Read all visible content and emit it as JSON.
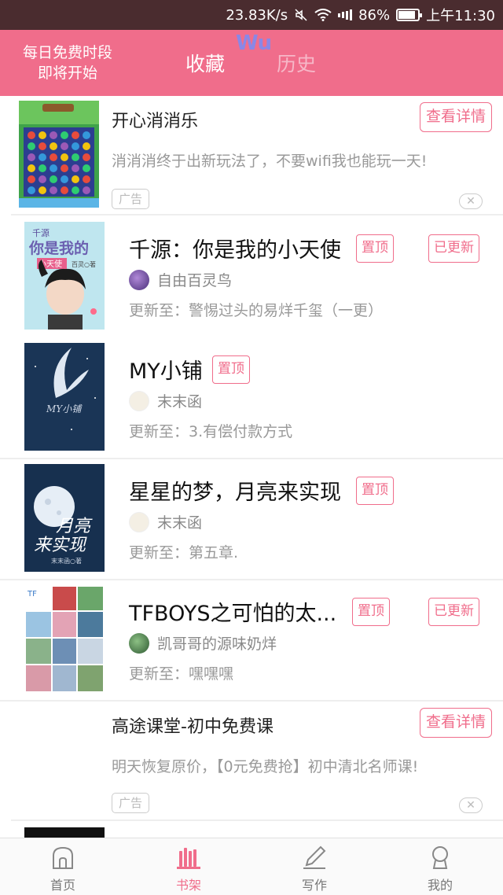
{
  "status_bar": {
    "net_speed": "23.83K/s",
    "battery": "86%",
    "battery_level": 0.86,
    "time": "上午11:30"
  },
  "header": {
    "promo_line1": "每日免费时段",
    "promo_line2": "即将开始",
    "tab_favorites": "收藏",
    "tab_history": "历史",
    "logo": "Wu"
  },
  "ads": [
    {
      "title": "开心消消乐",
      "description": "消消消终于出新玩法了，不要wifi我也能玩一天!",
      "button": "查看详情",
      "tag": "广告",
      "close": "✕"
    },
    {
      "title": "高途课堂-初中免费课",
      "description": "明天恢复原价，【0元免费抢】初中清北名师课!",
      "button": "查看详情",
      "tag": "广告",
      "close": "✕"
    }
  ],
  "books": [
    {
      "title": "千源：你是我的小天使",
      "pin_badge": "置顶",
      "updated_badge": "已更新",
      "author": "自由百灵鸟",
      "update": "更新至：警惕过头的易烊千玺（一更）"
    },
    {
      "title": "MY小铺",
      "pin_badge": "置顶",
      "author": "末末函",
      "update": "更新至：3.有偿付款方式"
    },
    {
      "title": "星星的梦，月亮来实现",
      "pin_badge": "置顶",
      "author": "末末函",
      "update": "更新至：第五章."
    },
    {
      "title": "TFBOYS之可怕的太...",
      "pin_badge": "置顶",
      "updated_badge": "已更新",
      "author": "凯哥哥的源味奶烊",
      "update": "更新至：嘿嘿嘿"
    }
  ],
  "covers": {
    "book1_top": "千源",
    "book1_main": "你是我的",
    "book1_sub": "小天使",
    "book1_author": "百灵○著",
    "book2_text": "MY小铺",
    "book3_main1": "月亮",
    "book3_main2": "来实现",
    "book3_author": "末末函○著",
    "book4_top": "TF"
  },
  "bottom_nav": [
    {
      "label": "首页",
      "icon": "home-icon"
    },
    {
      "label": "书架",
      "icon": "bookshelf-icon"
    },
    {
      "label": "写作",
      "icon": "pen-icon"
    },
    {
      "label": "我的",
      "icon": "profile-icon"
    }
  ],
  "colors": {
    "accent": "#f06d8b",
    "status_bar": "#4a2c2f",
    "inactive_tab": "#f6b8c8",
    "logo": "#8a87e6"
  }
}
